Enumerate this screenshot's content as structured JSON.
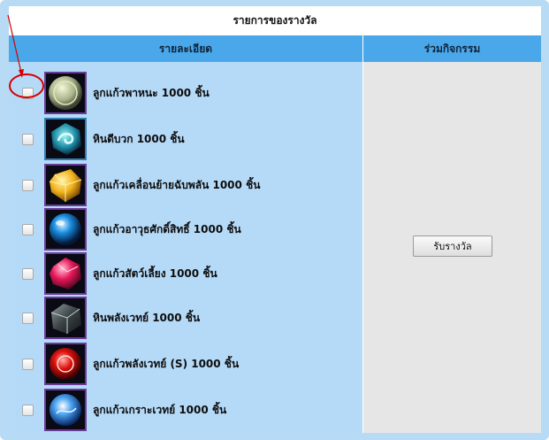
{
  "title": "รายการของรางวัล",
  "columns": {
    "details": "รายละเอียด",
    "activity": "ร่วมกิจกรรม"
  },
  "items": [
    {
      "label": "ลูกแก้วพาหนะ 1000 ชิ้น",
      "icon": "pale-green-orb-icon"
    },
    {
      "label": "หินดีบวก 1000 ชิ้น",
      "icon": "teal-swirl-stone-icon"
    },
    {
      "label": "ลูกแก้วเคลื่อนย้ายฉับพลัน 1000 ชิ้น",
      "icon": "yellow-crystal-icon"
    },
    {
      "label": "ลูกแก้วอาวุธศักดิ์สิทธิ์ 1000 ชิ้น",
      "icon": "blue-orb-icon"
    },
    {
      "label": "ลูกแก้วสัตว์เลี้ยง 1000 ชิ้น",
      "icon": "pink-gem-icon"
    },
    {
      "label": "หินพลังเวทย์ 1000 ชิ้น",
      "icon": "dark-stone-icon"
    },
    {
      "label": "ลูกแก้วพลังเวทย์ (S) 1000 ชิ้น",
      "icon": "red-orb-icon"
    },
    {
      "label": "ลูกแก้วเกราะเวทย์ 1000 ชิ้น",
      "icon": "light-blue-orb-icon"
    }
  ],
  "claim_button": "รับรางวัล",
  "colors": {
    "frame": "#b7daf5",
    "header": "#4aa8ea",
    "items_bg": "#b5daf8",
    "activity_bg": "#e6e6e6",
    "annotation": "#d40000"
  }
}
